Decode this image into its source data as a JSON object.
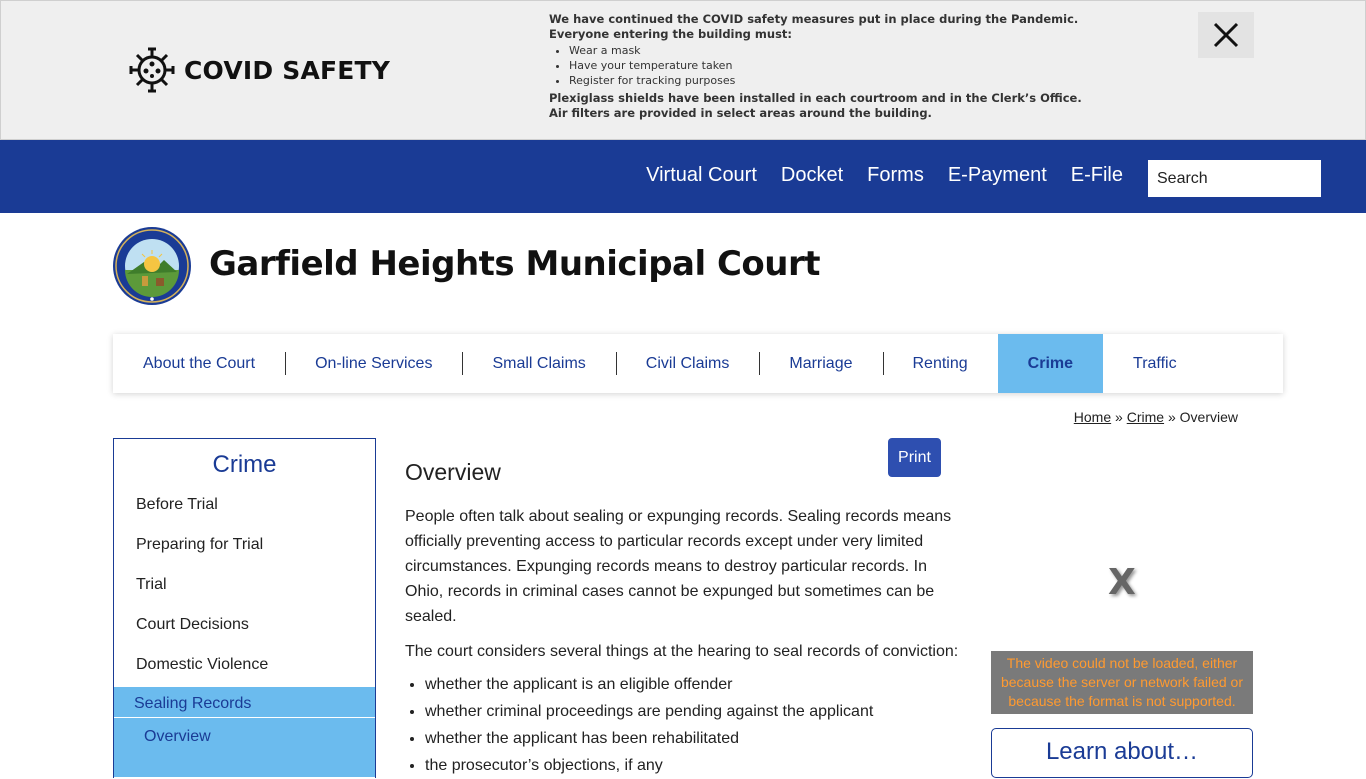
{
  "covid": {
    "title": "COVID SAFETY",
    "intro_1": "We have continued the COVID safety measures put in place during the Pandemic.",
    "intro_2": "Everyone entering the building must:",
    "measures": [
      "Wear a mask",
      "Have your temperature taken",
      "Register for tracking purposes"
    ],
    "note_1": "Plexiglass shields have been installed in each courtroom and in the Clerk’s Office.",
    "note_2": "Air filters are provided in select areas around the building.",
    "close_label": "✕"
  },
  "topnav": {
    "links": [
      "Virtual Court",
      "Docket",
      "Forms",
      "E-Payment",
      "E-File"
    ],
    "search_placeholder": "Search"
  },
  "header": {
    "title": "Garfield Heights Municipal Court"
  },
  "mainnav": {
    "items": [
      "About the Court",
      "On-line Services",
      "Small Claims",
      "Civil Claims",
      "Marriage",
      "Renting",
      "Crime",
      "Traffic"
    ],
    "active": "Crime"
  },
  "breadcrumb": {
    "home": "Home",
    "sep": "»",
    "section": "Crime",
    "current": "Overview"
  },
  "sidebar": {
    "title": "Crime",
    "items": [
      "Before Trial",
      "Preparing for Trial",
      "Trial",
      "Court Decisions",
      "Domestic Violence"
    ],
    "active_item": "Sealing Records",
    "sub_item": "Overview"
  },
  "content": {
    "print_label": "Print",
    "heading": "Overview",
    "para_1": "People often talk about sealing or expunging records.  Sealing records means officially preventing access to particular records except under very limited circumstances.  Expunging records means to destroy particular records.  In Ohio, records in criminal cases cannot be expunged but sometimes can be sealed.",
    "para_2": "The court considers several things at the hearing to seal records of conviction:",
    "bullets": [
      "whether the applicant is an eligible offender",
      "whether criminal proceedings are pending against the applicant",
      "whether the applicant has been rehabilitated",
      "the prosecutor’s objections, if any"
    ]
  },
  "right": {
    "video_x": "X",
    "video_error": "The video could not be loaded, either because the server or network failed or because the format is not supported.",
    "learn_title": "Learn about…"
  },
  "colors": {
    "brand_blue": "#1a3b95",
    "active_blue": "#6bbbee",
    "button_blue": "#2e4fb0",
    "error_orange": "#ff9a30"
  }
}
